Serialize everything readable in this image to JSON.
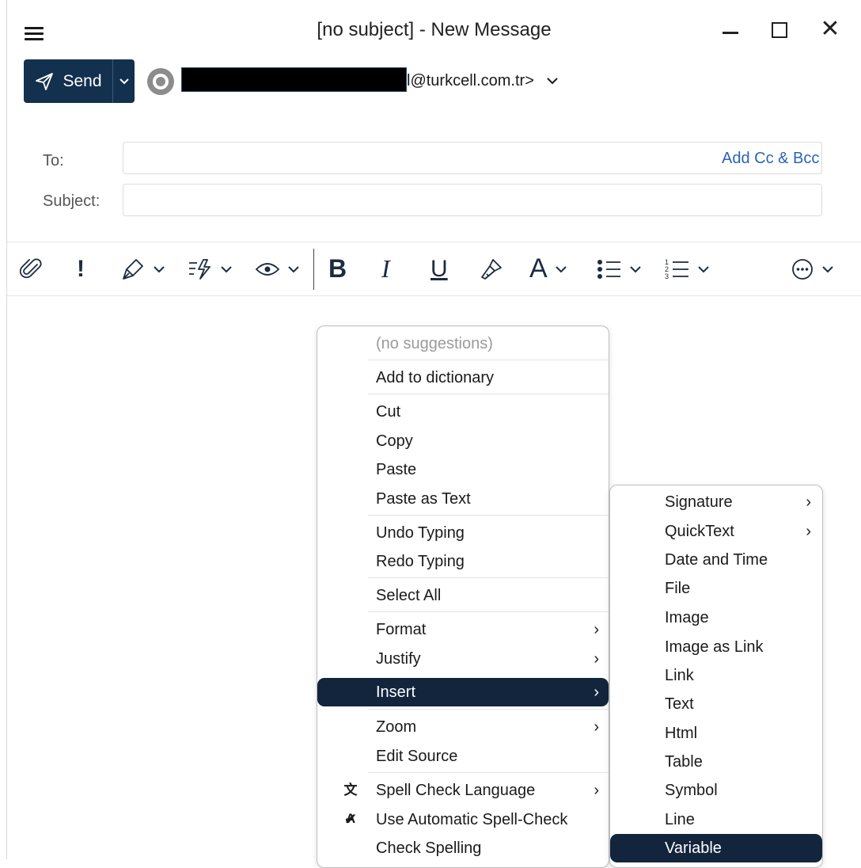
{
  "window": {
    "title": "[no subject] - New Message",
    "close_glyph": "✕"
  },
  "header": {
    "send_label": "Send",
    "from_email_suffix": "l@turkcell.com.tr>"
  },
  "fields": {
    "to_label": "To:",
    "subject_label": "Subject:",
    "add_cc_bcc": "Add Cc & Bcc",
    "to_value": "",
    "subject_value": ""
  },
  "toolbar": {
    "icons": [
      "attachment-icon",
      "priority-icon",
      "pen-icon",
      "quick-action-icon",
      "eye-icon",
      "bold-icon",
      "italic-icon",
      "underline-icon",
      "format-painter-icon",
      "font-icon",
      "bullet-list-icon",
      "numbered-list-icon",
      "more-icon"
    ],
    "priority_glyph": "!",
    "bold_glyph": "B",
    "italic_glyph": "I",
    "underline_glyph": "U",
    "font_glyph": "A"
  },
  "context_menu": {
    "items": [
      {
        "label": "(no suggestions)"
      },
      {
        "label": "Add to dictionary"
      },
      {
        "label": "Cut"
      },
      {
        "label": "Copy"
      },
      {
        "label": "Paste"
      },
      {
        "label": "Paste as Text"
      },
      {
        "label": "Undo Typing"
      },
      {
        "label": "Redo Typing"
      },
      {
        "label": "Select All"
      },
      {
        "label": "Format"
      },
      {
        "label": "Justify"
      },
      {
        "label": "Insert"
      },
      {
        "label": "Zoom"
      },
      {
        "label": "Edit Source"
      },
      {
        "label": "Spell Check Language"
      },
      {
        "label": "Use Automatic Spell-Check"
      },
      {
        "label": "Check Spelling"
      }
    ],
    "highlighted": "Insert",
    "checkmark_glyph": "✔",
    "translate_glyph": "文A"
  },
  "insert_submenu": {
    "items": [
      {
        "label": "Signature"
      },
      {
        "label": "QuickText"
      },
      {
        "label": "Date and Time"
      },
      {
        "label": "File"
      },
      {
        "label": "Image"
      },
      {
        "label": "Image as Link"
      },
      {
        "label": "Link"
      },
      {
        "label": "Text"
      },
      {
        "label": "Html"
      },
      {
        "label": "Table"
      },
      {
        "label": "Symbol"
      },
      {
        "label": "Line"
      },
      {
        "label": "Variable"
      }
    ],
    "highlighted": "Variable"
  },
  "colors": {
    "accent_dark": "#13304f",
    "menu_highlight": "#13253d",
    "link_blue": "#2b64b0"
  }
}
